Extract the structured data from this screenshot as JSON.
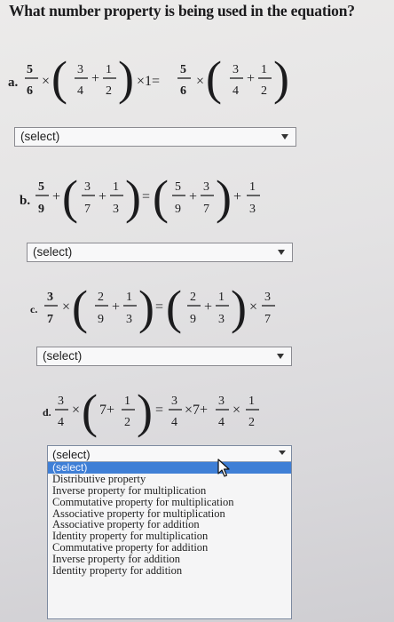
{
  "question": {
    "title": "What number property is being used in the equation?"
  },
  "equations": {
    "a": {
      "label": "a.",
      "f1": {
        "n": "5",
        "d": "6"
      },
      "op1": "×",
      "g1": {
        "n": "3",
        "d": "4"
      },
      "plus1": "+",
      "g2": {
        "n": "1",
        "d": "2"
      },
      "times_one": "×1=",
      "f2": {
        "n": "5",
        "d": "6"
      },
      "op2": "×",
      "g3": {
        "n": "3",
        "d": "4"
      },
      "plus2": "+",
      "g4": {
        "n": "1",
        "d": "2"
      }
    },
    "b": {
      "label": "b.",
      "f1": {
        "n": "5",
        "d": "9"
      },
      "op1": "+",
      "g1": {
        "n": "3",
        "d": "7"
      },
      "plus1": "+",
      "g2": {
        "n": "1",
        "d": "3"
      },
      "eq": "=",
      "g3": {
        "n": "5",
        "d": "9"
      },
      "plus2": "+",
      "g4": {
        "n": "3",
        "d": "7"
      },
      "plus3": "+",
      "f2": {
        "n": "1",
        "d": "3"
      }
    },
    "c": {
      "label": "c.",
      "f1": {
        "n": "3",
        "d": "7"
      },
      "op1": "×",
      "g1": {
        "n": "2",
        "d": "9"
      },
      "plus1": "+",
      "g2": {
        "n": "1",
        "d": "3"
      },
      "eq": "=",
      "g3": {
        "n": "2",
        "d": "9"
      },
      "plus2": "+",
      "g4": {
        "n": "1",
        "d": "3"
      },
      "op2": "×",
      "f2": {
        "n": "3",
        "d": "7"
      }
    },
    "d": {
      "label": "d.",
      "f1": {
        "n": "3",
        "d": "4"
      },
      "op1": "×",
      "whole": "7+",
      "g1": {
        "n": "1",
        "d": "2"
      },
      "eq": "=",
      "f2": {
        "n": "3",
        "d": "4"
      },
      "mid": "×7+",
      "f3": {
        "n": "3",
        "d": "4"
      },
      "op2": "×",
      "f4": {
        "n": "1",
        "d": "2"
      }
    }
  },
  "selects": {
    "a": {
      "value": "(select)"
    },
    "b": {
      "value": "(select)"
    },
    "c": {
      "value": "(select)"
    },
    "d": {
      "value": "(select)",
      "options": [
        "(select)",
        "Distributive property",
        "Inverse property for multiplication",
        "Commutative property for multiplication",
        "Associative property for multiplication",
        "Associative property for addition",
        "Identity property for multiplication",
        "Commutative property for addition",
        "Inverse property for addition",
        "Identity property for addition"
      ]
    }
  },
  "icons": {
    "arrow": "chevron-down-icon",
    "cursor": "mouse-pointer-icon"
  }
}
